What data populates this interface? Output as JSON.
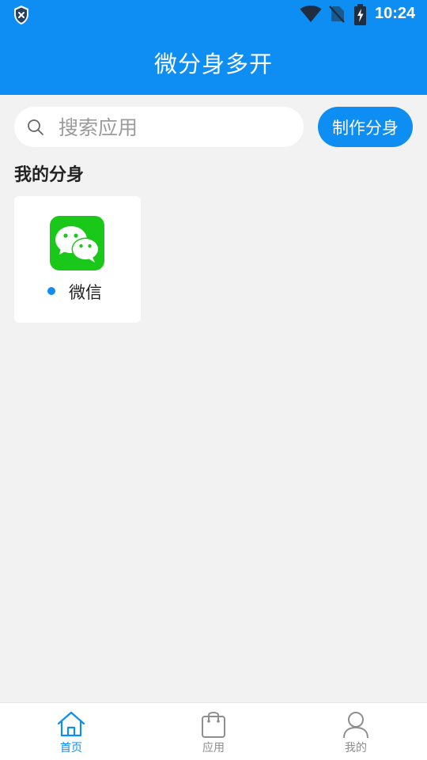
{
  "status_bar": {
    "time": "10:24",
    "icons": [
      "shield-x-icon",
      "wifi-icon",
      "no-sim-icon",
      "battery-charging-icon"
    ]
  },
  "header": {
    "title": "微分身多开"
  },
  "search": {
    "placeholder": "搜索应用",
    "value": "",
    "icon": "search-icon"
  },
  "make_clone_button": {
    "label": "制作分身"
  },
  "section": {
    "title": "我的分身"
  },
  "apps": [
    {
      "name": "微信",
      "icon": "wechat-icon",
      "running": true
    }
  ],
  "bottom_nav": {
    "items": [
      {
        "label": "首页",
        "icon": "home-icon",
        "active": true
      },
      {
        "label": "应用",
        "icon": "shopping-bag-icon",
        "active": false
      },
      {
        "label": "我的",
        "icon": "user-icon",
        "active": false
      }
    ]
  },
  "colors": {
    "primary": "#0e8ef3",
    "background": "#f2f2f2",
    "wechat_green": "#1ac81a",
    "inactive": "#8e8e8e"
  }
}
